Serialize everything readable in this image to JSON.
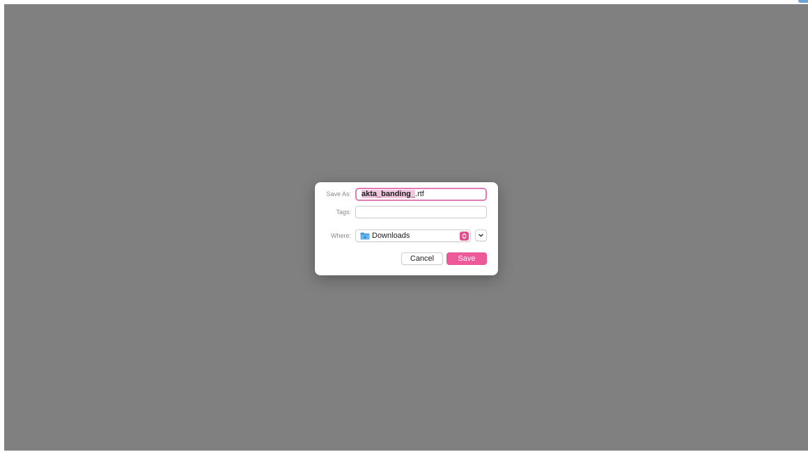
{
  "dialog": {
    "save_as_label": "Save As:",
    "filename": {
      "selected_name": "akta_banding_",
      "extension": ".rtf"
    },
    "tags_label": "Tags:",
    "tags_value": "",
    "where_label": "Where:",
    "where_value": "Downloads",
    "cancel_label": "Cancel",
    "save_label": "Save"
  },
  "icons": {
    "folder": "folder-icon",
    "stepper": "up-down-stepper-icon",
    "expand": "chevron-down-icon"
  },
  "colors": {
    "accent": "#ee5a99",
    "focus_ring": "#e37bb5",
    "selection": "#f1c6e0",
    "backdrop": "#808080"
  }
}
